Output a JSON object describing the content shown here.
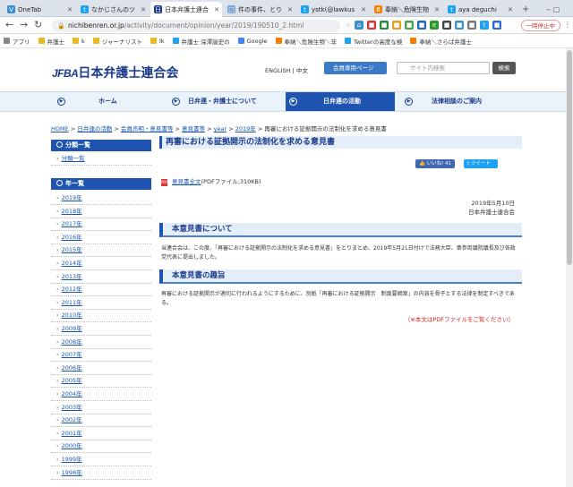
{
  "browser": {
    "tabs": [
      {
        "title": "OneTab",
        "icon": "onetab-icon",
        "color": "#3b8fd1"
      },
      {
        "title": "なかじさんのツ",
        "icon": "twitter-icon",
        "color": "#1da1f2"
      },
      {
        "title": "日本弁護士連合",
        "icon": "jfba-icon",
        "color": "#1a3a8a"
      },
      {
        "title": "件の事件、とり",
        "icon": "page-icon",
        "color": "#7aa6d6"
      },
      {
        "title": "ystk(@lawkus",
        "icon": "twitter-icon",
        "color": "#1da1f2"
      },
      {
        "title": "奉納＼危険生物",
        "icon": "blogger-icon",
        "color": "#f57d00"
      },
      {
        "title": "aya deguchi",
        "icon": "twitter-icon",
        "color": "#1da1f2"
      }
    ],
    "url_domain": "nichibenren.or.jp",
    "url_path": "/activity/document/opinion/year/2019/190510_2.html",
    "pause_label": "一時停止中",
    "bookmarks": [
      {
        "label": "アプリ",
        "color": "#888"
      },
      {
        "label": "弁護士",
        "color": "#e8b923"
      },
      {
        "label": "k",
        "color": "#e8b923"
      },
      {
        "label": "ジャーナリスト",
        "color": "#e8b923"
      },
      {
        "label": "lk",
        "color": "#e8b923"
      },
      {
        "label": "弁護士 深澤諭史の",
        "color": "#1da1f2"
      },
      {
        "label": "Google",
        "color": "#4285f4"
      },
      {
        "label": "奉納＼危険生物＼非",
        "color": "#f57d00"
      },
      {
        "label": "Twitterの高度な検",
        "color": "#1da1f2"
      },
      {
        "label": "奉納＼さらば弁護士",
        "color": "#f57d00"
      }
    ]
  },
  "site": {
    "logo_mark": "JFBA",
    "logo_text": "日本弁護士連合会",
    "lang_label": "ENGLISH | 中文",
    "member_button": "会員専用ページ",
    "search_placeholder": "サイト内検索",
    "search_button": "検索",
    "nav": [
      "ホーム",
      "日弁連・弁護士について",
      "日弁連の活動",
      "法律相談のご案内"
    ]
  },
  "breadcrumb": {
    "links": [
      "HOME",
      "日弁連の活動",
      "会員声明・意見書等",
      "意見書等",
      "year",
      "2019年"
    ],
    "current": "再審における証拠開示の法制化を求める意見書"
  },
  "sidebar": {
    "category_head": "分類一覧",
    "category_items": [
      "分類一覧"
    ],
    "year_head": "年一覧",
    "years": [
      "2019年",
      "2018年",
      "2017年",
      "2016年",
      "2015年",
      "2014年",
      "2013年",
      "2012年",
      "2011年",
      "2010年",
      "2009年",
      "2008年",
      "2007年",
      "2006年",
      "2005年",
      "2004年",
      "2003年",
      "2002年",
      "2001年",
      "2000年",
      "1999年",
      "1998年"
    ]
  },
  "main": {
    "title": "再審における証拠開示の法制化を求める意見書",
    "like_label": "いいね! 41",
    "tweet_label": "ツイート",
    "pdf_link": "意見書全文",
    "pdf_info": "(PDFファイル;310KB)",
    "date": "2019年5月10日",
    "org": "日本弁護士連合会",
    "section1_title": "本意見書について",
    "section1_text": "当連合会は、この度、「再審における証拠開示の法制化を求める意見書」をとりまとめ、2019年5月21日付けで法務大臣、衆参両議院議長及び各政党代表に提出しました。",
    "section2_title": "本意見書の趣旨",
    "section2_text": "再審における証拠開示が適切に行われるようにするために、別紙「再審における証拠開示　制度要綱案」の内容を骨子とする法律を制定すべきである。",
    "note": "（※本文はPDFファイルをご覧ください）"
  }
}
